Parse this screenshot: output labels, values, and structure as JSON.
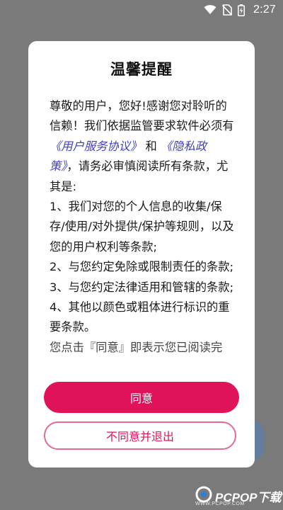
{
  "status_bar": {
    "time": "2:27",
    "icons": [
      "wifi-icon",
      "no-sim-icon",
      "battery-charging-icon"
    ]
  },
  "dialog": {
    "title": "温馨提醒",
    "body": {
      "intro_before_link1": "尊敬的用户，您好!感谢您对聆听的信赖！我们依据监管要求软件必须有",
      "link_user_agreement": "《用户服务协议》",
      "and": "和",
      "link_privacy_policy": "《隐私政策》",
      "intro_after_links": "，请务必审慎阅读所有条款，尤其是:",
      "item1": "1、我们对您的个人信息的收集/保存/使用/对外提供/保护等规则，以及您的用户权利等条款;",
      "item2": "2、与您约定免除或限制责任的条款;",
      "item3": "3、与您约定法律适用和管辖的条款;",
      "item4": "4、其他以颜色或粗体进行标识的重要条款。",
      "cutoff_line": "您点击『同意』即表示您已阅读完"
    },
    "agree_label": "同意",
    "disagree_label": "不同意并退出"
  },
  "colors": {
    "accent": "#e0125a",
    "link": "#3f3fc8",
    "backdrop": "#7a7a7a"
  },
  "watermark": {
    "brand": "PCPOP下载",
    "sub": "WWW.PCPOP.COM"
  }
}
